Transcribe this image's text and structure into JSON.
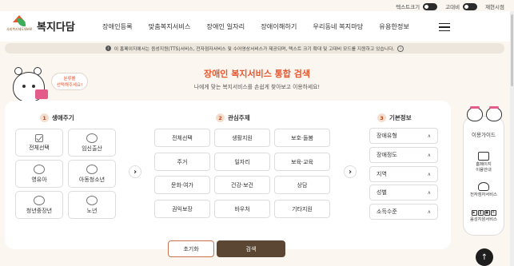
{
  "util": {
    "text_size_label": "텍스트크기",
    "contrast_label": "고대비",
    "reset_label": "재현시점"
  },
  "header": {
    "logo_sub": "사회복지제도WeW",
    "logo_text": "복지다담",
    "nav": [
      "장애인등록",
      "맞춤복지서비스",
      "장애인 일자리",
      "장애이해하기",
      "우리동네 복지마당",
      "유용한정보"
    ]
  },
  "notice": {
    "text": "이 홈페이지에서는 음성지원(TTS)서비스, 전자점자서비스 및 수어영상서비스가 제공되며, 텍스트 크기 확대 및 고대비 모드를 지원하고 있습니다.",
    "info_icon": "i",
    "arrow_icon": "›"
  },
  "mascot": {
    "bubble_line1": "분류를",
    "bubble_line2": "선택해주세요!"
  },
  "page": {
    "title": "장애인 복지서비스 통합 검색",
    "subtitle": "나에게 맞는 복지서비스를 손쉽게 찾아보고 이용하세요!"
  },
  "sections": {
    "life": {
      "num": "1",
      "label": "생애주기"
    },
    "interest": {
      "num": "2",
      "label": "관심주제"
    },
    "basic": {
      "num": "3",
      "label": "기본정보"
    }
  },
  "life_items": [
    "전체선택",
    "임신출산",
    "영유아",
    "아동청소년",
    "청년중장년",
    "노년"
  ],
  "interest_items": [
    "전체선택",
    "생활지원",
    "보호·돌봄",
    "주거",
    "일자리",
    "보육·교육",
    "문화·여가",
    "건강·보건",
    "상담",
    "권익보장",
    "바우처",
    "기타지원"
  ],
  "basic_items": [
    "장애유형",
    "장애정도",
    "지역",
    "성별",
    "소득수준"
  ],
  "actions": {
    "reset": "초기화",
    "search": "검색"
  },
  "guide": {
    "title": "이용가이드",
    "item1_line1": "홈페이지",
    "item1_line2": "이용안내",
    "item2": "전자점자서비스",
    "item3": "음성지원서비스"
  },
  "glyphs": {
    "next": "›",
    "caret_up": "∧",
    "top": "↑"
  },
  "colors": {
    "accent": "#e7572f",
    "search_bg": "#5a4632",
    "page_bg": "#fbf6ef"
  }
}
